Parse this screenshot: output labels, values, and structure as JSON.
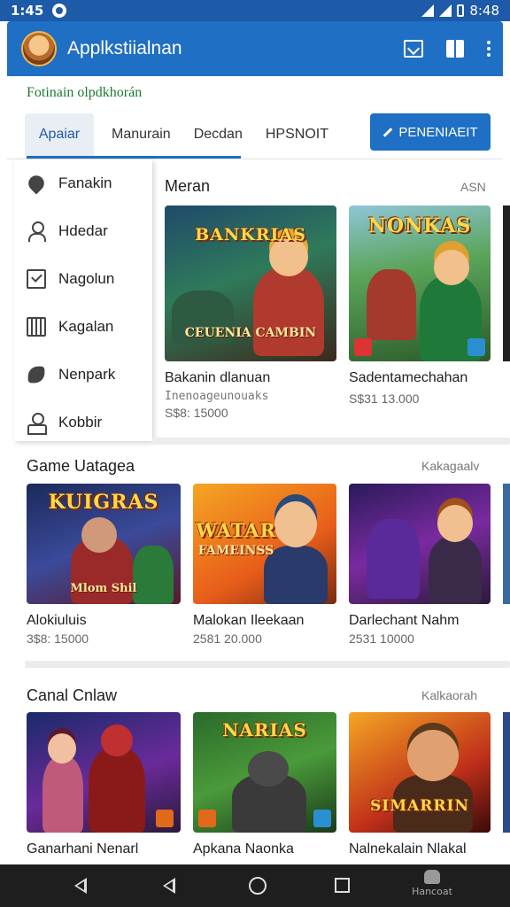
{
  "status_bar": {
    "time": "1:45",
    "right_time": "8:48"
  },
  "app_bar": {
    "title": "Applkstiialnan"
  },
  "subtitle": "Fotinain olpdkhorán",
  "tabs": [
    {
      "label": "Apaiar"
    },
    {
      "label": "Manurain"
    },
    {
      "label": "Decdan"
    },
    {
      "label": "HPSNOIT"
    }
  ],
  "action_button": {
    "label": "PENENIAEIT"
  },
  "side_menu": [
    {
      "label": "Fanakin",
      "icon": "pin-icon"
    },
    {
      "label": "Hdedar",
      "icon": "user-icon"
    },
    {
      "label": "Nagolun",
      "icon": "checkbox-icon"
    },
    {
      "label": "Kagalan",
      "icon": "calendar-icon"
    },
    {
      "label": "Nenpark",
      "icon": "bird-icon"
    },
    {
      "label": "Kobbir",
      "icon": "account-icon"
    }
  ],
  "section1": {
    "title": "Meran",
    "more": "ASN",
    "cards": [
      {
        "title": "Bakanin dlanuan",
        "sub": "Inenoageunouaks",
        "price": "S$8: 15000",
        "logo": "BANKRIAS",
        "sublogo": "CEUENIA CAMBIN"
      },
      {
        "title": "Sadentamechahan",
        "sub": "",
        "price": "S$31 13.000",
        "logo": "NONKAS",
        "sublogo": ""
      }
    ]
  },
  "section2": {
    "title": "Game Uatagea",
    "more": "Kakagaalv",
    "cards": [
      {
        "title": "Alokiuluis",
        "price": "3$8: 15000",
        "logo": "KUIGRAS",
        "sublogo": "Mlom Shil"
      },
      {
        "title": "Malokan Ileekaan",
        "price": "2581 20.000",
        "logo": "WATAR",
        "sublogo": "FAMEINSS"
      },
      {
        "title": "Darlechant Nahm",
        "price": "2531 10000",
        "logo": "",
        "sublogo": ""
      }
    ]
  },
  "section3": {
    "title": "Canal Cnlaw",
    "more": "Kalkaorah",
    "cards": [
      {
        "title": "Ganarhani Nenarl",
        "logo": ""
      },
      {
        "title": "Apkana Naonka",
        "logo": "NARIAS"
      },
      {
        "title": "Nalnekalain Nlakal",
        "logo": "SIMARRIN"
      }
    ]
  },
  "nav_bar": {
    "extra_label": "Hancoat"
  },
  "colors": {
    "primary": "#1f6fc4",
    "status_bar": "#1d5aa8",
    "subtitle": "#1b7a2f"
  }
}
